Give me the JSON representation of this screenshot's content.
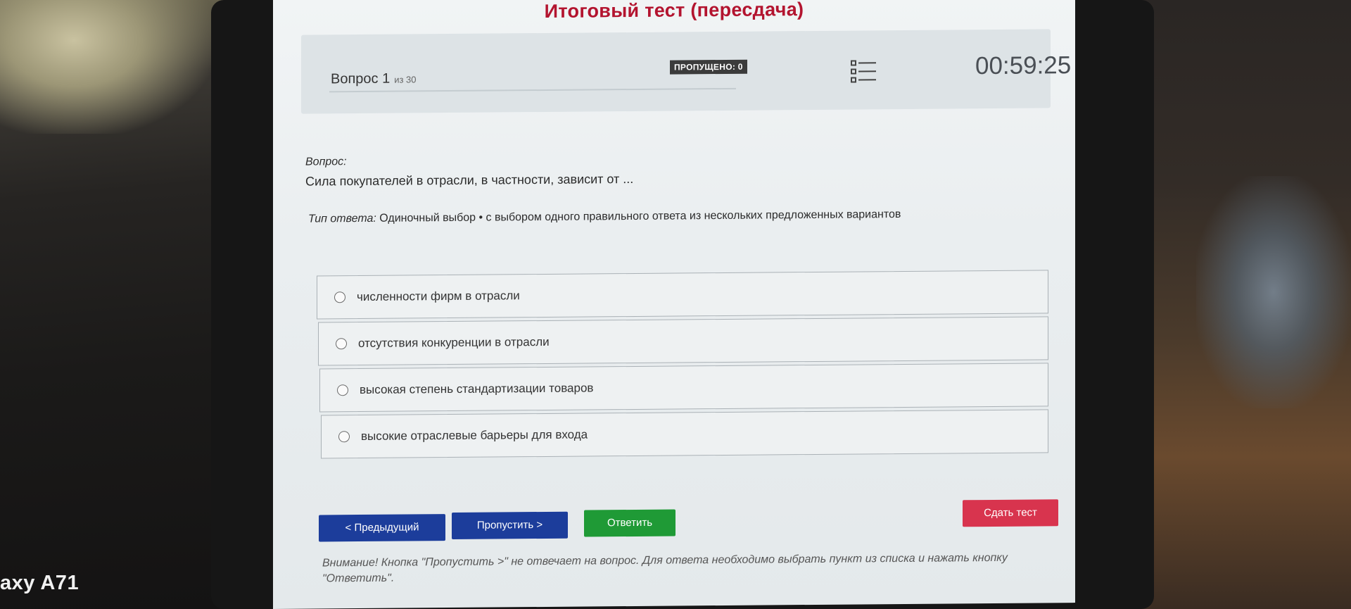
{
  "app": {
    "title": "Итоговый тест (пересдача)"
  },
  "header": {
    "question_label": "Вопрос 1",
    "question_of": "из 30",
    "skipped_badge": "ПРОПУЩЕНО: 0",
    "list_icon": "list-icon",
    "timer": "00:59:25"
  },
  "question": {
    "label": "Вопрос:",
    "text": "Сила покупателей в отрасли, в частности, зависит от ...",
    "answer_type_label": "Тип ответа:",
    "answer_type": "Одиночный выбор • с выбором одного правильного ответа из нескольких предложенных вариантов"
  },
  "options": [
    {
      "label": "численности фирм в отрасли",
      "selected": false
    },
    {
      "label": "отсутствия конкуренции в отрасли",
      "selected": false
    },
    {
      "label": "высокая степень стандартизации товаров",
      "selected": false
    },
    {
      "label": "высокие отраслевые барьеры для входа",
      "selected": false
    }
  ],
  "buttons": {
    "prev": "< Предыдущий",
    "skip": "Пропустить >",
    "answer": "Ответить",
    "submit": "Сдать тест"
  },
  "warning": "Внимание! Кнопка \"Пропустить >\" не отвечает на вопрос. Для ответа необходимо выбрать пункт из списка и нажать кнопку \"Ответить\".",
  "device_label": "axy A71",
  "colors": {
    "title": "#b3142f",
    "primary_button": "#1c3d9b",
    "answer_button": "#1f9a36",
    "submit_button": "#d8344e",
    "badge": "#3b3b3b"
  }
}
